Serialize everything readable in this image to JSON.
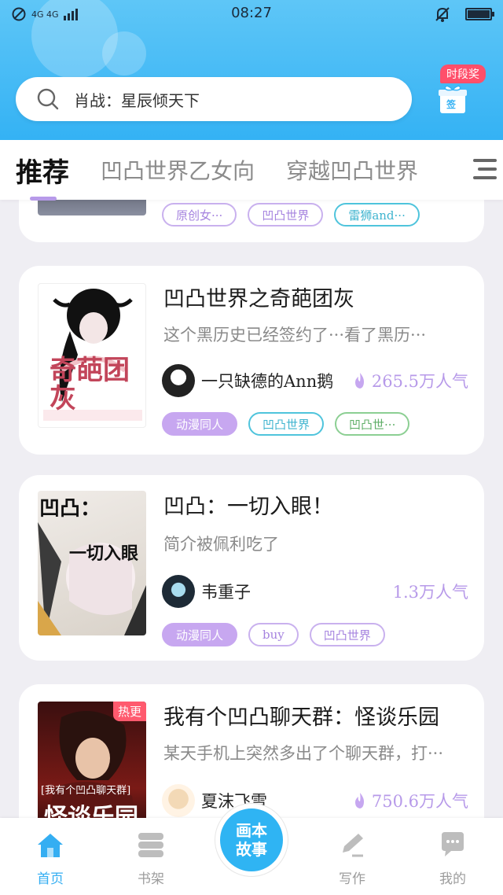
{
  "status_bar": {
    "network": "4G 4G",
    "time": "08:27"
  },
  "search": {
    "text": "肖战：星辰倾天下"
  },
  "checkin": {
    "badge": "时段奖",
    "label": "签"
  },
  "tabs": [
    {
      "label": "推荐",
      "active": true
    },
    {
      "label": "凹凸世界乙女向",
      "active": false
    },
    {
      "label": "穿越凹凸世界",
      "active": false
    }
  ],
  "top_card_tags": [
    "原创女···",
    "凹凸世界",
    "雷狮and···"
  ],
  "stories": [
    {
      "title": "凹凸世界之奇葩团灰",
      "description": "这个黑历史已经签约了···看了黑历···",
      "author": "一只缺德的Ann鹅",
      "popularity": "265.5万人气",
      "show_fire": true,
      "tags": [
        "动漫同人",
        "凹凸世界",
        "凹凸世···"
      ],
      "cover_text": "奇葩团灰"
    },
    {
      "title": "凹凸：一切入眼！",
      "description": "简介被佩利吃了",
      "author": "韦重子",
      "popularity": "1.3万人气",
      "show_fire": false,
      "tags": [
        "动漫同人",
        "buy",
        "凹凸世界"
      ],
      "cover_text_top": "凹凸：",
      "cover_text_bottom": "一切入眼"
    },
    {
      "title": "我有个凹凸聊天群：怪谈乐园",
      "description": "某天手机上突然多出了个聊天群，打···",
      "author": "夏沫飞雪",
      "popularity": "750.6万人气",
      "show_fire": true,
      "hot_badge": "热更",
      "cover_text_top": "[我有个凹凸聊天群]",
      "cover_text_bottom": "怪谈乐园"
    }
  ],
  "bottom_nav": {
    "home": "首页",
    "bookshelf": "书架",
    "center_line1": "画本",
    "center_line2": "故事",
    "write": "写作",
    "mine": "我的"
  },
  "colors": {
    "accent_blue": "#34b2f4",
    "accent_purple": "#b79ae9",
    "hot_red": "#ff5a6e"
  }
}
